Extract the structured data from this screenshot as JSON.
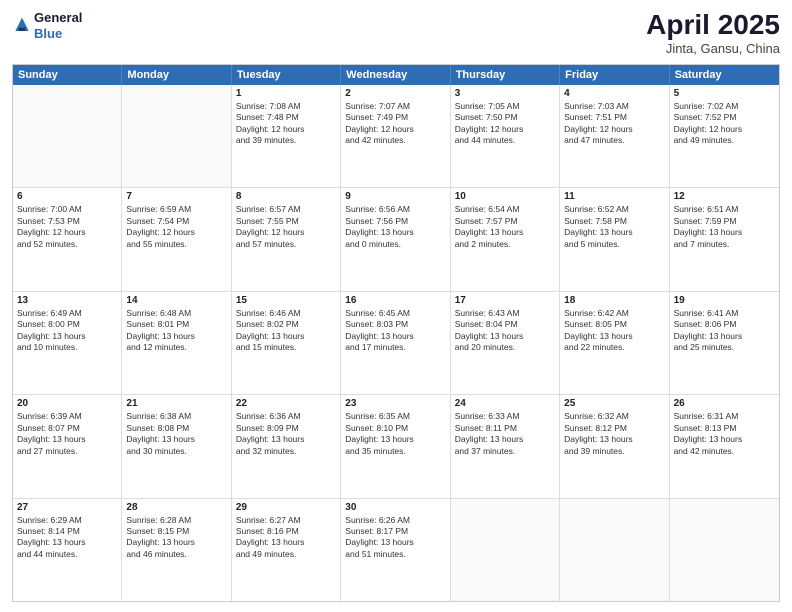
{
  "header": {
    "logo_line1": "General",
    "logo_line2": "Blue",
    "title": "April 2025",
    "subtitle": "Jinta, Gansu, China"
  },
  "calendar": {
    "days": [
      "Sunday",
      "Monday",
      "Tuesday",
      "Wednesday",
      "Thursday",
      "Friday",
      "Saturday"
    ],
    "rows": [
      [
        {
          "day": "",
          "text": ""
        },
        {
          "day": "",
          "text": ""
        },
        {
          "day": "1",
          "text": "Sunrise: 7:08 AM\nSunset: 7:48 PM\nDaylight: 12 hours\nand 39 minutes."
        },
        {
          "day": "2",
          "text": "Sunrise: 7:07 AM\nSunset: 7:49 PM\nDaylight: 12 hours\nand 42 minutes."
        },
        {
          "day": "3",
          "text": "Sunrise: 7:05 AM\nSunset: 7:50 PM\nDaylight: 12 hours\nand 44 minutes."
        },
        {
          "day": "4",
          "text": "Sunrise: 7:03 AM\nSunset: 7:51 PM\nDaylight: 12 hours\nand 47 minutes."
        },
        {
          "day": "5",
          "text": "Sunrise: 7:02 AM\nSunset: 7:52 PM\nDaylight: 12 hours\nand 49 minutes."
        }
      ],
      [
        {
          "day": "6",
          "text": "Sunrise: 7:00 AM\nSunset: 7:53 PM\nDaylight: 12 hours\nand 52 minutes."
        },
        {
          "day": "7",
          "text": "Sunrise: 6:59 AM\nSunset: 7:54 PM\nDaylight: 12 hours\nand 55 minutes."
        },
        {
          "day": "8",
          "text": "Sunrise: 6:57 AM\nSunset: 7:55 PM\nDaylight: 12 hours\nand 57 minutes."
        },
        {
          "day": "9",
          "text": "Sunrise: 6:56 AM\nSunset: 7:56 PM\nDaylight: 13 hours\nand 0 minutes."
        },
        {
          "day": "10",
          "text": "Sunrise: 6:54 AM\nSunset: 7:57 PM\nDaylight: 13 hours\nand 2 minutes."
        },
        {
          "day": "11",
          "text": "Sunrise: 6:52 AM\nSunset: 7:58 PM\nDaylight: 13 hours\nand 5 minutes."
        },
        {
          "day": "12",
          "text": "Sunrise: 6:51 AM\nSunset: 7:59 PM\nDaylight: 13 hours\nand 7 minutes."
        }
      ],
      [
        {
          "day": "13",
          "text": "Sunrise: 6:49 AM\nSunset: 8:00 PM\nDaylight: 13 hours\nand 10 minutes."
        },
        {
          "day": "14",
          "text": "Sunrise: 6:48 AM\nSunset: 8:01 PM\nDaylight: 13 hours\nand 12 minutes."
        },
        {
          "day": "15",
          "text": "Sunrise: 6:46 AM\nSunset: 8:02 PM\nDaylight: 13 hours\nand 15 minutes."
        },
        {
          "day": "16",
          "text": "Sunrise: 6:45 AM\nSunset: 8:03 PM\nDaylight: 13 hours\nand 17 minutes."
        },
        {
          "day": "17",
          "text": "Sunrise: 6:43 AM\nSunset: 8:04 PM\nDaylight: 13 hours\nand 20 minutes."
        },
        {
          "day": "18",
          "text": "Sunrise: 6:42 AM\nSunset: 8:05 PM\nDaylight: 13 hours\nand 22 minutes."
        },
        {
          "day": "19",
          "text": "Sunrise: 6:41 AM\nSunset: 8:06 PM\nDaylight: 13 hours\nand 25 minutes."
        }
      ],
      [
        {
          "day": "20",
          "text": "Sunrise: 6:39 AM\nSunset: 8:07 PM\nDaylight: 13 hours\nand 27 minutes."
        },
        {
          "day": "21",
          "text": "Sunrise: 6:38 AM\nSunset: 8:08 PM\nDaylight: 13 hours\nand 30 minutes."
        },
        {
          "day": "22",
          "text": "Sunrise: 6:36 AM\nSunset: 8:09 PM\nDaylight: 13 hours\nand 32 minutes."
        },
        {
          "day": "23",
          "text": "Sunrise: 6:35 AM\nSunset: 8:10 PM\nDaylight: 13 hours\nand 35 minutes."
        },
        {
          "day": "24",
          "text": "Sunrise: 6:33 AM\nSunset: 8:11 PM\nDaylight: 13 hours\nand 37 minutes."
        },
        {
          "day": "25",
          "text": "Sunrise: 6:32 AM\nSunset: 8:12 PM\nDaylight: 13 hours\nand 39 minutes."
        },
        {
          "day": "26",
          "text": "Sunrise: 6:31 AM\nSunset: 8:13 PM\nDaylight: 13 hours\nand 42 minutes."
        }
      ],
      [
        {
          "day": "27",
          "text": "Sunrise: 6:29 AM\nSunset: 8:14 PM\nDaylight: 13 hours\nand 44 minutes."
        },
        {
          "day": "28",
          "text": "Sunrise: 6:28 AM\nSunset: 8:15 PM\nDaylight: 13 hours\nand 46 minutes."
        },
        {
          "day": "29",
          "text": "Sunrise: 6:27 AM\nSunset: 8:16 PM\nDaylight: 13 hours\nand 49 minutes."
        },
        {
          "day": "30",
          "text": "Sunrise: 6:26 AM\nSunset: 8:17 PM\nDaylight: 13 hours\nand 51 minutes."
        },
        {
          "day": "",
          "text": ""
        },
        {
          "day": "",
          "text": ""
        },
        {
          "day": "",
          "text": ""
        }
      ]
    ]
  }
}
